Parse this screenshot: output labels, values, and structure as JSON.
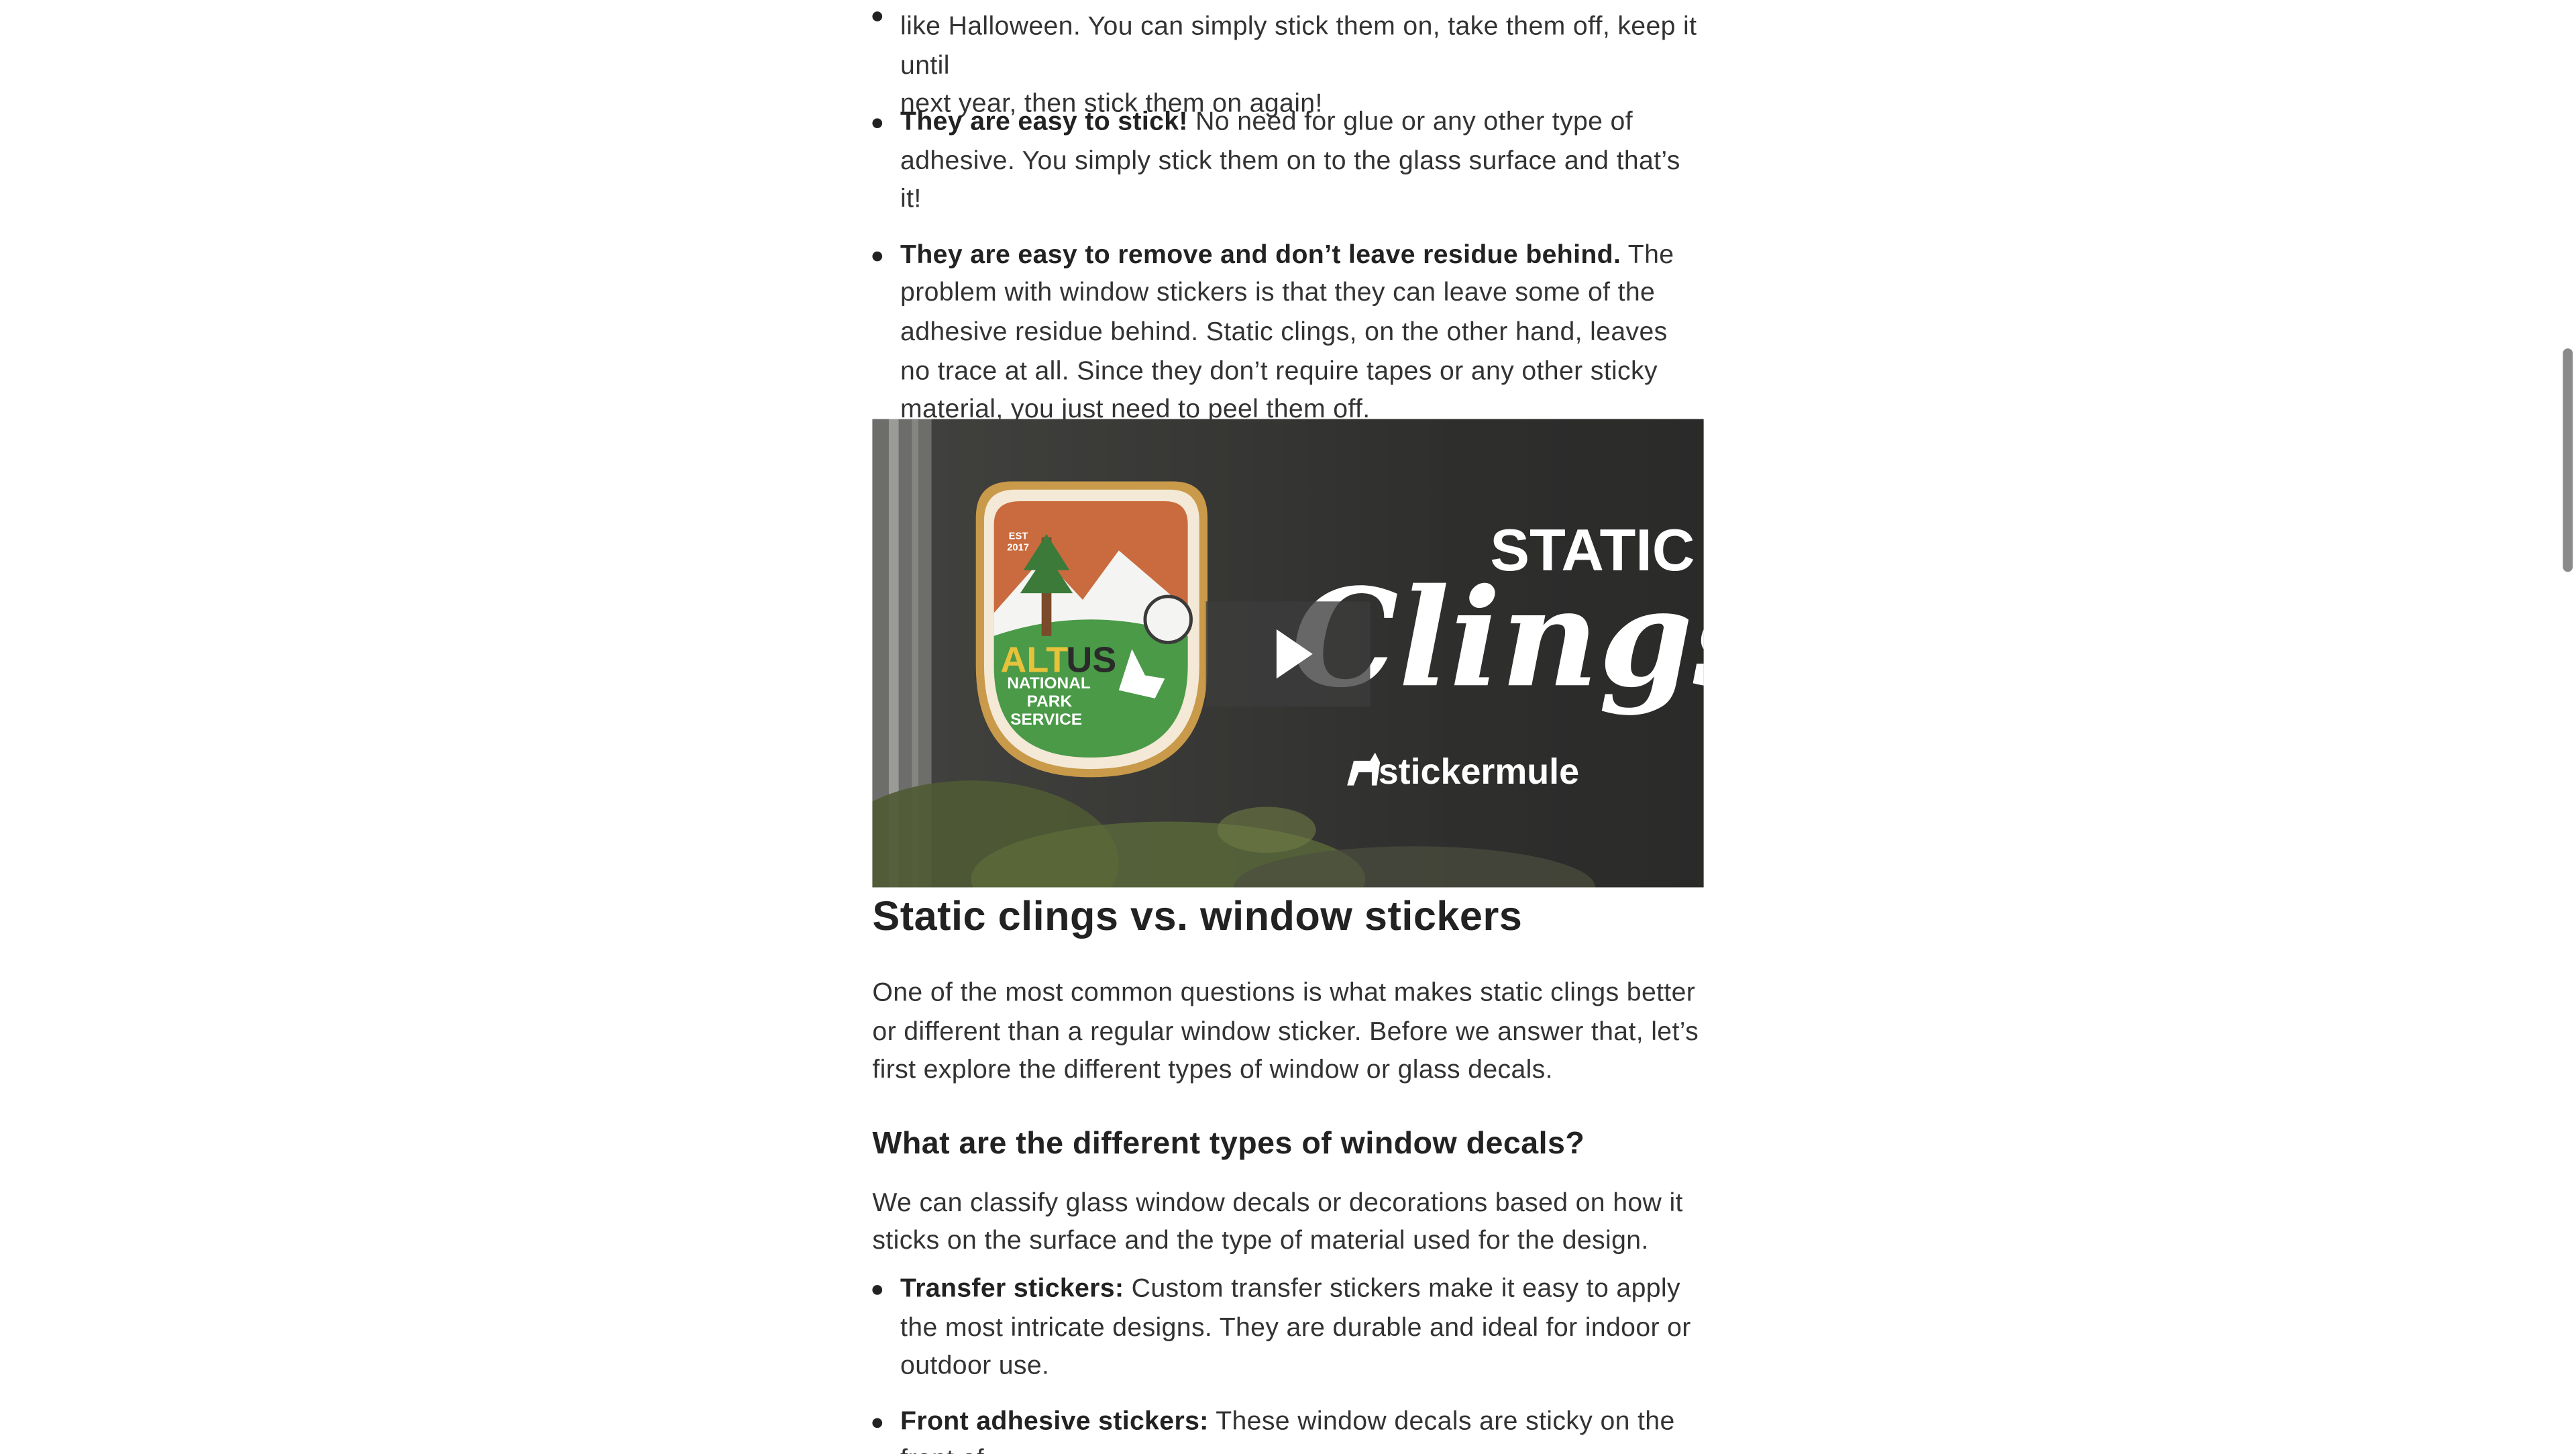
{
  "benefits_list": {
    "item1_tail_line1": "like Halloween. You can simply stick them on, take them off, keep it until",
    "item1_tail_line2": "next year, then stick them on again!",
    "item2_bold": "They are easy to stick!",
    "item2_text": "No need for glue or any other type of adhesive. You simply stick them on to the glass surface and that’s it!",
    "item3_bold": "They are easy to remove and don’t leave residue behind.",
    "item3_text": "The problem with window stickers is that they can leave some of the adhesive residue behind. Static clings, on the other hand, leaves no trace at all. Since they don’t require tapes or any other sticky material, you just need to peel them off."
  },
  "video": {
    "badge_est": "EST",
    "badge_year": "2017",
    "badge_alt": "ALT",
    "badge_us": "US",
    "badge_line1": "NATIONAL",
    "badge_line2": "PARK",
    "badge_line3": "SERVICE",
    "title_static": "STATIC",
    "title_clings": "Clings",
    "brand": "stickermule",
    "play_icon": "play-icon"
  },
  "section": {
    "heading": "Static clings vs. window stickers",
    "intro": "One of the most common questions is what makes static clings better or different than a regular window sticker. Before we answer that, let’s first explore the different types of window or glass decals.",
    "subheading": "What are the different types of window decals?",
    "classify": "We can classify glass window decals or decorations based on how it sticks on the surface and the type of material used for the design."
  },
  "types_list": {
    "item1_bold": "Transfer stickers:",
    "item1_text": "Custom transfer stickers make it easy to apply the most intricate designs. They are durable and ideal for indoor or outdoor use.",
    "item2_bold": "Front adhesive stickers:",
    "item2_text": "These window decals are sticky on the front of"
  }
}
